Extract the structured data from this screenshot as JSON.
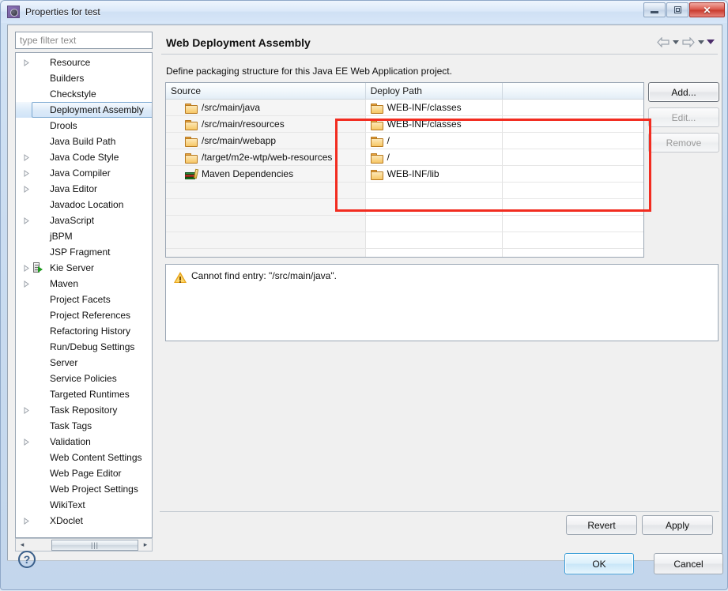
{
  "window": {
    "title": "Properties for test",
    "app_icon": "gear-icon",
    "minimize_label": "Minimize",
    "maximize_label": "Maximize",
    "close_label": "✕"
  },
  "sidebar": {
    "filter_placeholder": "type filter text",
    "filter_value": "",
    "items": [
      {
        "label": "Resource",
        "expandable": true,
        "icon": null,
        "selected": false
      },
      {
        "label": "Builders",
        "expandable": false,
        "icon": null,
        "selected": false
      },
      {
        "label": "Checkstyle",
        "expandable": false,
        "icon": null,
        "selected": false
      },
      {
        "label": "Deployment Assembly",
        "expandable": false,
        "icon": null,
        "selected": true
      },
      {
        "label": "Drools",
        "expandable": false,
        "icon": null,
        "selected": false
      },
      {
        "label": "Java Build Path",
        "expandable": false,
        "icon": null,
        "selected": false
      },
      {
        "label": "Java Code Style",
        "expandable": true,
        "icon": null,
        "selected": false
      },
      {
        "label": "Java Compiler",
        "expandable": true,
        "icon": null,
        "selected": false
      },
      {
        "label": "Java Editor",
        "expandable": true,
        "icon": null,
        "selected": false
      },
      {
        "label": "Javadoc Location",
        "expandable": false,
        "icon": null,
        "selected": false
      },
      {
        "label": "JavaScript",
        "expandable": true,
        "icon": null,
        "selected": false
      },
      {
        "label": "jBPM",
        "expandable": false,
        "icon": null,
        "selected": false
      },
      {
        "label": "JSP Fragment",
        "expandable": false,
        "icon": null,
        "selected": false
      },
      {
        "label": "Kie Server",
        "expandable": true,
        "icon": "kie-server-icon",
        "selected": false
      },
      {
        "label": "Maven",
        "expandable": true,
        "icon": null,
        "selected": false
      },
      {
        "label": "Project Facets",
        "expandable": false,
        "icon": null,
        "selected": false
      },
      {
        "label": "Project References",
        "expandable": false,
        "icon": null,
        "selected": false
      },
      {
        "label": "Refactoring History",
        "expandable": false,
        "icon": null,
        "selected": false
      },
      {
        "label": "Run/Debug Settings",
        "expandable": false,
        "icon": null,
        "selected": false
      },
      {
        "label": "Server",
        "expandable": false,
        "icon": null,
        "selected": false
      },
      {
        "label": "Service Policies",
        "expandable": false,
        "icon": null,
        "selected": false
      },
      {
        "label": "Targeted Runtimes",
        "expandable": false,
        "icon": null,
        "selected": false
      },
      {
        "label": "Task Repository",
        "expandable": true,
        "icon": null,
        "selected": false
      },
      {
        "label": "Task Tags",
        "expandable": false,
        "icon": null,
        "selected": false
      },
      {
        "label": "Validation",
        "expandable": true,
        "icon": null,
        "selected": false
      },
      {
        "label": "Web Content Settings",
        "expandable": false,
        "icon": null,
        "selected": false
      },
      {
        "label": "Web Page Editor",
        "expandable": false,
        "icon": null,
        "selected": false
      },
      {
        "label": "Web Project Settings",
        "expandable": false,
        "icon": null,
        "selected": false
      },
      {
        "label": "WikiText",
        "expandable": false,
        "icon": null,
        "selected": false
      },
      {
        "label": "XDoclet",
        "expandable": true,
        "icon": null,
        "selected": false
      }
    ],
    "scroll_left_label": "◂",
    "scroll_right_label": "▸",
    "scroll_thumb_grip": "|||"
  },
  "page": {
    "title": "Web Deployment Assembly",
    "description": "Define packaging structure for this Java EE Web Application project.",
    "nav": {
      "back_icon": "arrow-left-icon",
      "back_menu_icon": "chevron-down-icon",
      "forward_icon": "arrow-right-icon",
      "forward_menu_icon": "chevron-down-icon",
      "view_menu_icon": "caret-down-icon"
    }
  },
  "table": {
    "columns": [
      "Source",
      "Deploy Path",
      ""
    ],
    "sort_column": "Source",
    "sort_direction": "ascending",
    "rows": [
      {
        "icon": "folder-icon",
        "source": "/src/main/java",
        "deploy_icon": "folder-icon",
        "deploy": "WEB-INF/classes"
      },
      {
        "icon": "folder-icon",
        "source": "/src/main/resources",
        "deploy_icon": "folder-icon",
        "deploy": "WEB-INF/classes"
      },
      {
        "icon": "folder-icon",
        "source": "/src/main/webapp",
        "deploy_icon": "folder-icon",
        "deploy": "/"
      },
      {
        "icon": "folder-icon",
        "source": "/target/m2e-wtp/web-resources",
        "deploy_icon": "folder-icon",
        "deploy": "/"
      },
      {
        "icon": "maven-dependencies-icon",
        "source": "Maven Dependencies",
        "deploy_icon": "folder-icon",
        "deploy": "WEB-INF/lib"
      }
    ],
    "empty_row_count": 12
  },
  "side_buttons": [
    {
      "label": "Add...",
      "enabled": true
    },
    {
      "label": "Edit...",
      "enabled": false
    },
    {
      "label": "Remove",
      "enabled": false
    }
  ],
  "message": {
    "icon": "warning-icon",
    "text": "Cannot find entry: \"/src/main/java\"."
  },
  "page_buttons": {
    "revert": "Revert",
    "apply": "Apply"
  },
  "footer": {
    "help_icon": "help-icon",
    "help_label": "?",
    "ok": "OK",
    "cancel": "Cancel"
  },
  "annotation": {
    "type": "highlight-rectangle",
    "color": "#f22c20"
  }
}
